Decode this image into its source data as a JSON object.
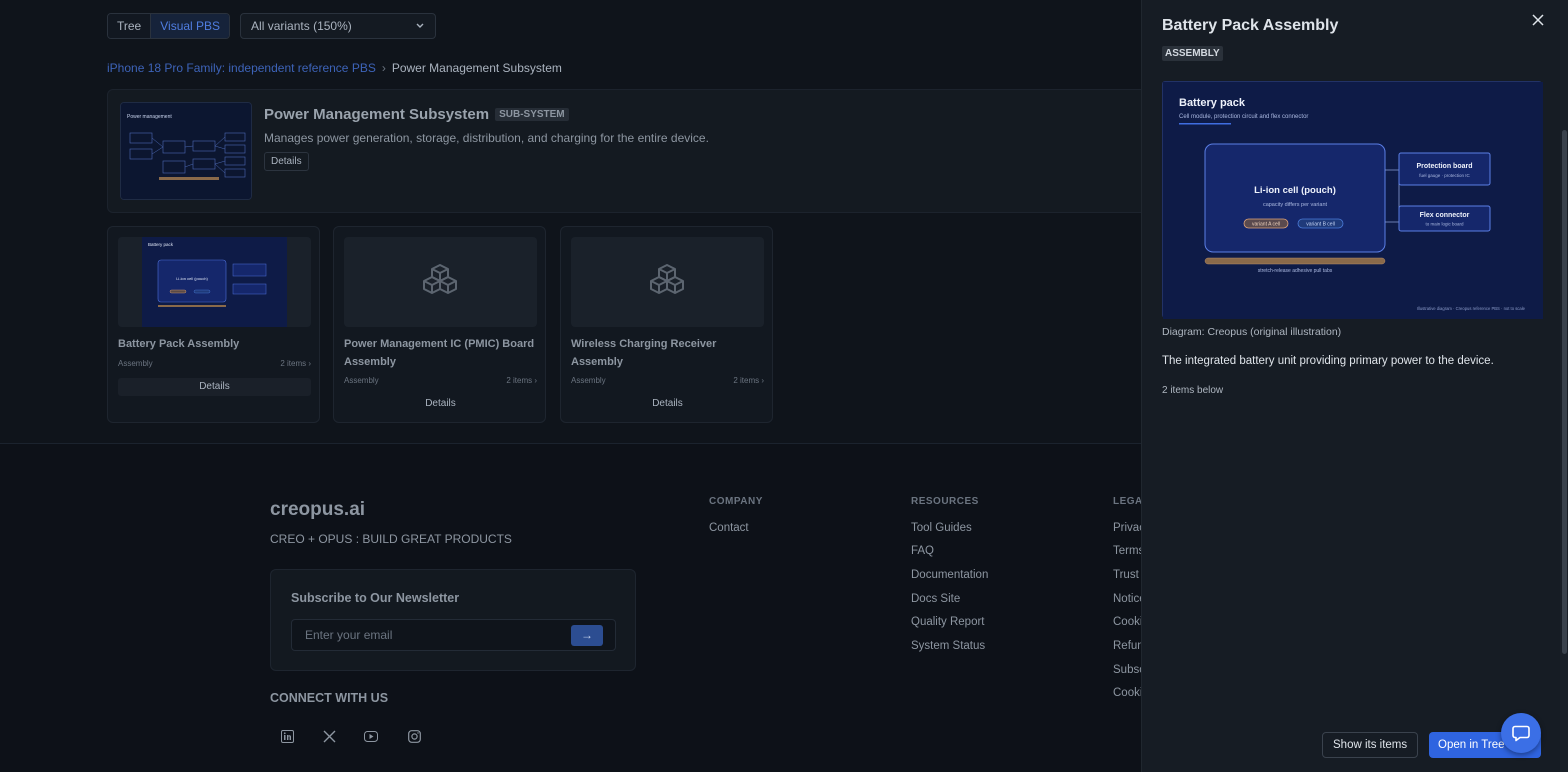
{
  "toolbar": {
    "view_tree": "Tree",
    "view_visual": "Visual PBS",
    "variant_select": "All variants (150%)"
  },
  "breadcrumb": {
    "root": "iPhone 18 Pro Family: independent reference PBS",
    "current": "Power Management Subsystem"
  },
  "subsystem": {
    "title": "Power Management Subsystem",
    "badge": "SUB-SYSTEM",
    "description": "Manages power generation, storage, distribution, and charging for the entire device.",
    "details": "Details",
    "thumb_title": "Power management"
  },
  "cards": [
    {
      "title": "Battery Pack Assembly",
      "type": "Assembly",
      "count": "2 items ›",
      "details": "Details"
    },
    {
      "title": "Power Management IC (PMIC) Board Assembly",
      "type": "Assembly",
      "count": "2 items ›",
      "details": "Details"
    },
    {
      "title": "Wireless Charging Receiver Assembly",
      "type": "Assembly",
      "count": "2 items ›",
      "details": "Details"
    }
  ],
  "footer": {
    "brand": "creopus.ai",
    "tagline": "CREO + OPUS : BUILD GREAT PRODUCTS",
    "newsletter_title": "Subscribe to Our Newsletter",
    "email_placeholder": "Enter your email",
    "connect": "CONNECT WITH US",
    "company_head": "COMPANY",
    "company_links": [
      "Contact"
    ],
    "resources_head": "RESOURCES",
    "resources_links": [
      "Tool Guides",
      "FAQ",
      "Documentation",
      "Docs Site",
      "Quality Report",
      "System Status"
    ],
    "legal_head": "LEGAL",
    "legal_links": [
      "Privacy",
      "Terms",
      "Trust",
      "Notice",
      "Cookie",
      "Refund",
      "Subscr",
      "Cookie"
    ],
    "socials": [
      "linkedin-icon",
      "x-icon",
      "youtube-icon",
      "instagram-icon"
    ]
  },
  "panel": {
    "title": "Battery Pack Assembly",
    "badge": "ASSEMBLY",
    "caption": "Diagram: Creopus (original illustration)",
    "description": "The integrated battery unit providing primary power to the device.",
    "items_below": "2 items below",
    "show_items": "Show its items",
    "open_tree": "Open in Tree",
    "diagram": {
      "title": "Battery pack",
      "subtitle": "Cell module, protection circuit and flex connector",
      "cell_title": "Li-ion cell (pouch)",
      "cell_sub": "capacity differs per variant",
      "variant_a": "variant A cell",
      "variant_b": "variant B cell",
      "protection_title": "Protection board",
      "protection_sub": "fuel gauge · protection IC",
      "flex_title": "Flex connector",
      "flex_sub": "to main logic board",
      "tabs_label": "stretch-release adhesive pull tabs",
      "footnote": "Illustrative diagram · Creopus reference PBS · not to scale"
    }
  },
  "colors": {
    "accent": "#2f64e0",
    "diagram_bg": "#0e1b47",
    "cell_fill": "#15276b",
    "variant_a": "#e0a57a",
    "variant_b": "#4a7bd9"
  }
}
